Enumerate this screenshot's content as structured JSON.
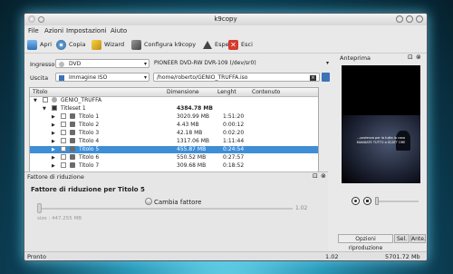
{
  "window": {
    "title": "k9copy"
  },
  "menu": [
    "File",
    "Azioni",
    "Impostazioni",
    "Aiuto"
  ],
  "toolbar": {
    "open": "Apri",
    "copy": "Copia",
    "wizard": "Wizard",
    "configure": "Configura k9copy",
    "eject": "Espelli",
    "exit": "Esci"
  },
  "input": {
    "label": "Ingresso",
    "source_type": "DVD",
    "device": "PIONEER DVD-RW  DVR-109  (/dev/sr0)"
  },
  "output": {
    "label": "Uscita",
    "type": "Immagine ISO",
    "path": "/home/roberto/GENIO_TRUFFA.iso"
  },
  "preview_panel": {
    "title": "Anteprima"
  },
  "tree": {
    "columns": [
      "Titolo",
      "Dimensione",
      "Lenght",
      "Contenuto"
    ],
    "root": "GENIO_TRUFFA",
    "titleset": {
      "name": "Titleset 1",
      "size": "4384.78 MB"
    },
    "rows": [
      {
        "name": "Titolo 1",
        "size": "3020.99 MB",
        "length": "1:51:20"
      },
      {
        "name": "Titolo 2",
        "size": "4.43 MB",
        "length": "0:00:12"
      },
      {
        "name": "Titolo 3",
        "size": "42.18 MB",
        "length": "0:02:20"
      },
      {
        "name": "Titolo 4",
        "size": "1317.06 MB",
        "length": "1:11:44"
      },
      {
        "name": "Titolo 5",
        "size": "455.87 MB",
        "length": "0:24:54"
      },
      {
        "name": "Titolo 6",
        "size": "550.52 MB",
        "length": "0:27:57"
      },
      {
        "name": "Titolo 7",
        "size": "309.68 MB",
        "length": "0:18:52"
      }
    ],
    "selected_index": 4
  },
  "factor_panel": {
    "title": "Fattore di riduzione",
    "heading": "Fattore di riduzione per Titolo 5",
    "checkbox": "Cambia fattore",
    "slider_value": "1.02",
    "size_text": "size : 447.255 MB",
    "slider_min": "1.02"
  },
  "video": {
    "subtitle_line1": "...pazienza per la tutta la cosa",
    "subtitle_line2": "MANDATE TUTTO a SCATT ORE"
  },
  "preview_tabs": [
    "Opzioni riproduzione",
    "Sel.",
    "Ante."
  ],
  "status": {
    "left": "Pronto",
    "center": "1.02",
    "right": "5701.72 Mb"
  },
  "colors": {
    "selection": "#3e8ed6",
    "accent_glow": "#6ad8ec"
  }
}
